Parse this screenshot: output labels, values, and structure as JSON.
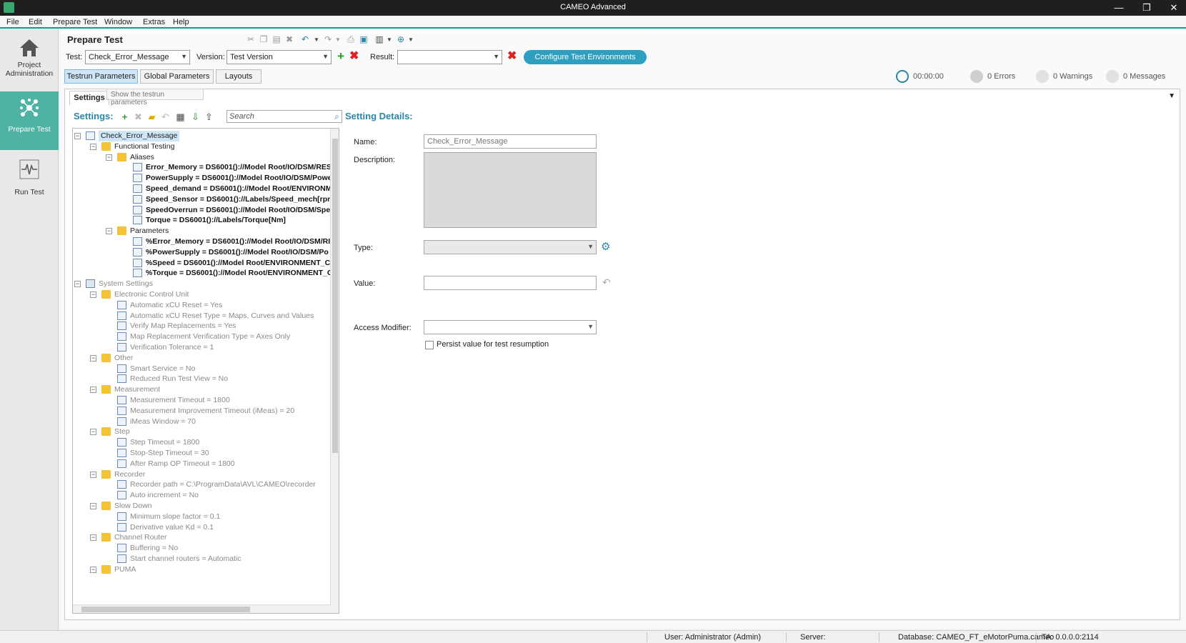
{
  "window": {
    "title": "CAMEO Advanced",
    "minimize": "—",
    "restore": "❐",
    "close": "✕"
  },
  "menu": [
    "File",
    "Edit",
    "Prepare Test",
    "Window",
    "Extras",
    "Help"
  ],
  "nav": [
    {
      "label1": "Project",
      "label2": "Administration",
      "icon": "home-icon"
    },
    {
      "label1": "Prepare Test",
      "label2": "",
      "icon": "molecule-icon"
    },
    {
      "label1": "Run Test",
      "label2": "",
      "icon": "run-test-icon"
    }
  ],
  "page_title": "Prepare Test",
  "controls": {
    "test_label": "Test:",
    "test_value": "Check_Error_Message",
    "version_label": "Version:",
    "version_value": "Test Version",
    "result_label": "Result:",
    "result_value": "",
    "configure_button": "Configure Test Environments"
  },
  "tabs": [
    "Testrun Parameters",
    "Global Parameters",
    "Layouts"
  ],
  "tooltip": "Show the testrun parameters",
  "status": {
    "time": "00:00:00",
    "errors": "0 Errors",
    "warnings": "0 Warnings",
    "messages": "0 Messages"
  },
  "subtab": "Settings",
  "settings_title": "Settings:",
  "search_placeholder": "Search",
  "tree": [
    {
      "level": 0,
      "type": "root",
      "text": "Check_Error_Message",
      "style": "sel"
    },
    {
      "level": 1,
      "type": "folder",
      "text": "Functional Testing",
      "style": ""
    },
    {
      "level": 2,
      "type": "folder",
      "text": "Aliases",
      "style": ""
    },
    {
      "level": 3,
      "type": "leaf",
      "text": "Error_Memory = DS6001()://Model Root/IO/DSM/RES",
      "style": "bold"
    },
    {
      "level": 3,
      "type": "leaf",
      "text": "PowerSupply = DS6001()://Model Root/IO/DSM/Powe",
      "style": "bold"
    },
    {
      "level": 3,
      "type": "leaf",
      "text": "Speed_demand = DS6001()://Model Root/ENVIRONM",
      "style": "bold"
    },
    {
      "level": 3,
      "type": "leaf",
      "text": "Speed_Sensor = DS6001()://Labels/Speed_mech[rpm]",
      "style": "bold"
    },
    {
      "level": 3,
      "type": "leaf",
      "text": "SpeedOverrun = DS6001()://Model Root/IO/DSM/Spe",
      "style": "bold"
    },
    {
      "level": 3,
      "type": "leaf",
      "text": "Torque = DS6001()://Labels/Torque[Nm]",
      "style": "bold"
    },
    {
      "level": 2,
      "type": "folder",
      "text": "Parameters",
      "style": ""
    },
    {
      "level": 3,
      "type": "leaf",
      "text": "%Error_Memory = DS6001()://Model Root/IO/DSM/RI",
      "style": "bold"
    },
    {
      "level": 3,
      "type": "leaf",
      "text": "%PowerSupply = DS6001()://Model Root/IO/DSM/Po",
      "style": "bold"
    },
    {
      "level": 3,
      "type": "leaf",
      "text": "%Speed = DS6001()://Model Root/ENVIRONMENT_CO",
      "style": "bold"
    },
    {
      "level": 3,
      "type": "leaf",
      "text": "%Torque = DS6001()://Model Root/ENVIRONMENT_C",
      "style": "bold"
    },
    {
      "level": 0,
      "type": "gear",
      "text": "System Settings",
      "style": "grey"
    },
    {
      "level": 1,
      "type": "folder",
      "text": "Electronic Control Unit",
      "style": "grey"
    },
    {
      "level": 2,
      "type": "leaf",
      "text": "Automatic xCU Reset = Yes",
      "style": "grey"
    },
    {
      "level": 2,
      "type": "leaf",
      "text": "Automatic xCU Reset Type = Maps, Curves and Values",
      "style": "grey"
    },
    {
      "level": 2,
      "type": "leaf",
      "text": "Verify Map Replacements = Yes",
      "style": "grey"
    },
    {
      "level": 2,
      "type": "leaf",
      "text": "Map Replacement Verification Type = Axes Only",
      "style": "grey"
    },
    {
      "level": 2,
      "type": "leaf",
      "text": "Verification Tolerance = 1",
      "style": "grey"
    },
    {
      "level": 1,
      "type": "folder",
      "text": "Other",
      "style": "grey"
    },
    {
      "level": 2,
      "type": "leaf",
      "text": "Smart Service = No",
      "style": "grey"
    },
    {
      "level": 2,
      "type": "leaf",
      "text": "Reduced Run Test View = No",
      "style": "grey"
    },
    {
      "level": 1,
      "type": "folder",
      "text": "Measurement",
      "style": "grey"
    },
    {
      "level": 2,
      "type": "leaf",
      "text": "Measurement Timeout = 1800",
      "style": "grey"
    },
    {
      "level": 2,
      "type": "leaf",
      "text": "Measurement Improvement Timeout (iMeas) = 20",
      "style": "grey"
    },
    {
      "level": 2,
      "type": "leaf",
      "text": "iMeas Window = 70",
      "style": "grey"
    },
    {
      "level": 1,
      "type": "folder",
      "text": "Step",
      "style": "grey"
    },
    {
      "level": 2,
      "type": "leaf",
      "text": "Step Timeout = 1800",
      "style": "grey"
    },
    {
      "level": 2,
      "type": "leaf",
      "text": "Stop-Step Timeout = 30",
      "style": "grey"
    },
    {
      "level": 2,
      "type": "leaf",
      "text": "After Ramp OP Timeout = 1800",
      "style": "grey"
    },
    {
      "level": 1,
      "type": "folder",
      "text": "Recorder",
      "style": "grey"
    },
    {
      "level": 2,
      "type": "leaf",
      "text": "Recorder path = C:\\ProgramData\\AVL\\CAMEO\\recorder",
      "style": "grey"
    },
    {
      "level": 2,
      "type": "leaf",
      "text": "Auto increment = No",
      "style": "grey"
    },
    {
      "level": 1,
      "type": "folder",
      "text": "Slow Down",
      "style": "grey"
    },
    {
      "level": 2,
      "type": "leaf",
      "text": "Minimum slope factor = 0.1",
      "style": "grey"
    },
    {
      "level": 2,
      "type": "leaf",
      "text": "Derivative value Kd = 0.1",
      "style": "grey"
    },
    {
      "level": 1,
      "type": "folder",
      "text": "Channel Router",
      "style": "grey"
    },
    {
      "level": 2,
      "type": "leaf",
      "text": "Buffering = No",
      "style": "grey"
    },
    {
      "level": 2,
      "type": "leaf",
      "text": "Start channel routers = Automatic",
      "style": "grey"
    },
    {
      "level": 1,
      "type": "folder",
      "text": "PUMA",
      "style": "grey"
    }
  ],
  "details": {
    "title": "Setting Details:",
    "name_label": "Name:",
    "name_value": "Check_Error_Message",
    "description_label": "Description:",
    "type_label": "Type:",
    "value_label": "Value:",
    "access_label": "Access Modifier:",
    "persist_label": "Persist value for test resumption"
  },
  "statusbar": {
    "user": "User: Administrator (Admin)",
    "server": "Server:",
    "database": "Database: CAMEO_FT_eMotorPuma.cameo",
    "ta": "TA: 0.0.0.0:2114"
  }
}
